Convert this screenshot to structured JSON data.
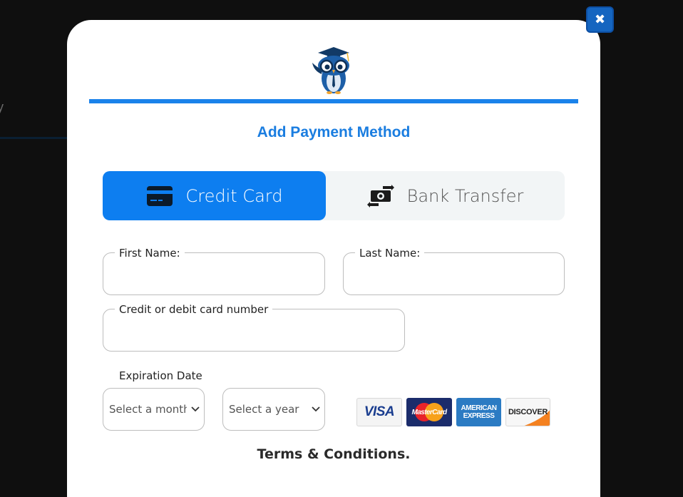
{
  "background": {
    "partial_text": "y"
  },
  "modal": {
    "title": "Add Payment Method",
    "close_label": "✖",
    "accent_color": "#1a82ea"
  },
  "tabs": [
    {
      "label": "Credit Card",
      "icon": "credit-card-icon",
      "active": true
    },
    {
      "label": "Bank Transfer",
      "icon": "money-transfer-icon",
      "active": false
    }
  ],
  "form": {
    "first_name": {
      "label": "First Name:",
      "value": ""
    },
    "last_name": {
      "label": "Last Name:",
      "value": ""
    },
    "card_number": {
      "label": "Credit or debit card number",
      "value": ""
    },
    "expiration": {
      "label": "Expiration Date",
      "month_placeholder": "Select a month",
      "year_placeholder": "Select a year"
    }
  },
  "card_brands": [
    {
      "name": "VISA",
      "icon": "visa-logo"
    },
    {
      "name": "MasterCard",
      "icon": "mastercard-logo"
    },
    {
      "name": "AMERICAN EXPRESS",
      "icon": "amex-logo"
    },
    {
      "name": "DISCOVER",
      "icon": "discover-logo"
    }
  ],
  "terms_label": "Terms & Conditions."
}
